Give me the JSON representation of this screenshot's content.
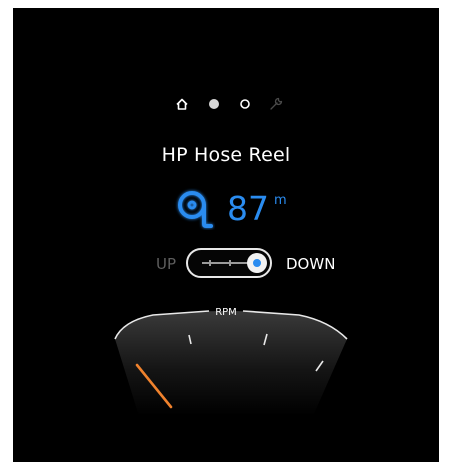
{
  "page_indicators": [
    {
      "icon": "home-icon",
      "active": false
    },
    {
      "icon": "dot-filled-icon",
      "active": true
    },
    {
      "icon": "dot-outline-icon",
      "active": false
    },
    {
      "icon": "wrench-icon",
      "active": false
    }
  ],
  "title": "HP Hose Reel",
  "hose_length": {
    "value": "87",
    "unit": "m",
    "icon": "hose-reel-icon"
  },
  "direction_toggle": {
    "left_label": "UP",
    "right_label": "DOWN",
    "selected": "DOWN"
  },
  "rpm_gauge": {
    "label": "RPM",
    "needle_color": "#f0822d"
  },
  "colors": {
    "accent": "#2a8cf0",
    "background": "#000000",
    "text": "#ffffff",
    "muted": "#5e5e5e",
    "needle": "#f0822d"
  }
}
